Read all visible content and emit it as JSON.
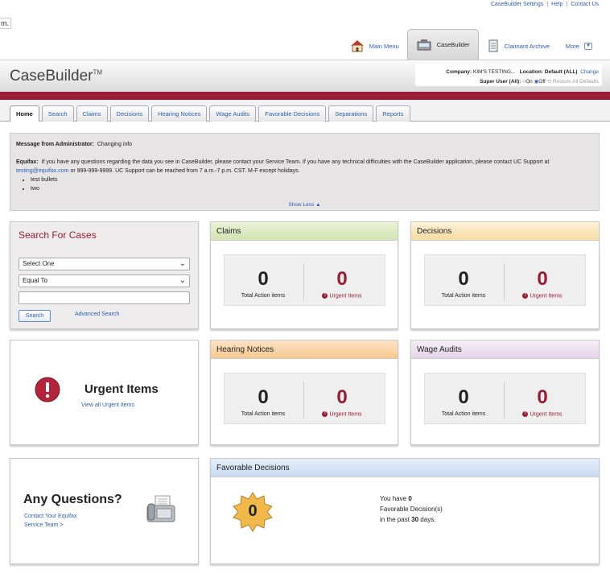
{
  "top_links": {
    "settings": "CaseBuilder Settings",
    "help": "Help",
    "contact": "Contact Us"
  },
  "menu_stub": "m.",
  "nav": {
    "main_menu": "Main Menu",
    "casebuilder": "CaseBuilder",
    "claimant_archive": "Claimant Archive",
    "more": "More"
  },
  "header": {
    "logo": "CaseBuilder",
    "tm": "TM",
    "company_label": "Company:",
    "company_value": "KIM'S TESTING...",
    "location_label": "Location:",
    "location_value": "Default (ALL)",
    "change": "Change",
    "super_user_label": "Super User (All):",
    "on": "On",
    "off": "Off",
    "restore": "Restore All Defaults"
  },
  "tabs": [
    "Home",
    "Search",
    "Claims",
    "Decisions",
    "Hearing Notices",
    "Wage Audits",
    "Favorable Decisions",
    "Separations",
    "Reports"
  ],
  "message": {
    "title": "Message from Administrator:",
    "subject": "Changing info",
    "company": "Equifax:",
    "body1": "If you have any questions regarding the data you see in CaseBuilder, please contact your Service Team. If you have any technical difficulties with the CaseBuilder application, please contact UC Support at",
    "email": "testing@equifax.com",
    "body2": "or 999-999-9999. UC Support can be reached from 7 a.m.-7 p.m. CST. M-F except holidays.",
    "bullets": [
      "test bullets",
      "two"
    ],
    "show_less": "Show Less"
  },
  "search": {
    "title": "Search For Cases",
    "field_select": "Select One",
    "operator_select": "Equal To",
    "value": "",
    "search_button": "Search",
    "advanced": "Advanced Search"
  },
  "cards": {
    "claims": {
      "title": "Claims",
      "total": "0",
      "total_label": "Total Action items",
      "urgent": "0",
      "urgent_label": "Urgent Items"
    },
    "decisions": {
      "title": "Decisions",
      "total": "0",
      "total_label": "Total Action items",
      "urgent": "0",
      "urgent_label": "Urgent Items"
    },
    "hearing": {
      "title": "Hearing Notices",
      "total": "0",
      "total_label": "Total Action items",
      "urgent": "0",
      "urgent_label": "Urgent Items"
    },
    "wage": {
      "title": "Wage Audits",
      "total": "0",
      "total_label": "Total Action items",
      "urgent": "0",
      "urgent_label": "Urgent Items"
    }
  },
  "urgent": {
    "title": "Urgent Items",
    "link": "View all Urgent Items"
  },
  "questions": {
    "title": "Any Questions?",
    "link1": "Contact Your Equifax",
    "link2": "Service Team >"
  },
  "favorable": {
    "title": "Favorable Decisions",
    "badge": "0",
    "line1": "You have",
    "count": "0",
    "line2": "Favorable Decision(s)",
    "line3a": "in the past",
    "days": "30",
    "line3b": "days."
  },
  "colors": {
    "brand_red": "#9a1b35",
    "link_blue": "#2b5fb3",
    "claims_header": "#dde9c4",
    "decisions_header": "#fbe7bf",
    "hearing_header": "#fbd8b2",
    "wage_header": "#ecdcef",
    "favorable_header": "#d6e4f5"
  }
}
